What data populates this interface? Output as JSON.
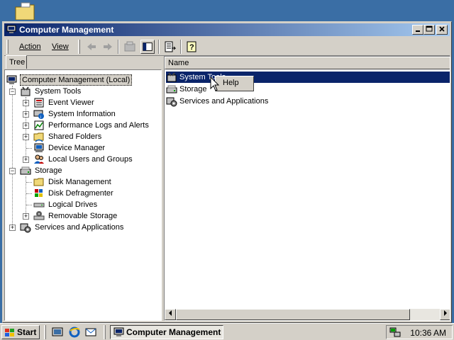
{
  "window": {
    "title": "Computer Management"
  },
  "menu": {
    "action": "Action",
    "view": "View"
  },
  "tree": {
    "tab_label": "Tree",
    "root": "Computer Management (Local)",
    "items": [
      "System Tools",
      "Event Viewer",
      "System Information",
      "Performance Logs and Alerts",
      "Shared Folders",
      "Device Manager",
      "Local Users and Groups",
      "Storage",
      "Disk Management",
      "Disk Defragmenter",
      "Logical Drives",
      "Removable Storage",
      "Services and Applications"
    ]
  },
  "list": {
    "column_name": "Name",
    "rows": [
      "System Tools",
      "Storage",
      "Services and Applications"
    ]
  },
  "context_menu": {
    "help": "Help"
  },
  "taskbar": {
    "start": "Start",
    "task": "Computer Management",
    "clock": "10:36 AM"
  },
  "colors": {
    "titlebar_start": "#0a246a",
    "titlebar_end": "#a6caf0",
    "selection": "#0a246a",
    "desktop": "#3a6ea5",
    "chrome": "#d4d0c8"
  }
}
